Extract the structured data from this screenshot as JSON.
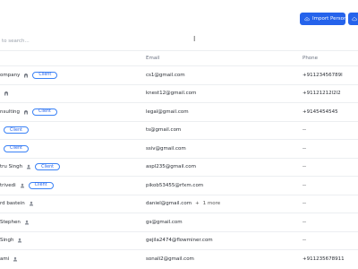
{
  "toolbar": {
    "import_label": "Import Person"
  },
  "search": {
    "placeholder": "to search..."
  },
  "table": {
    "columns": {
      "name": "",
      "email": "Email",
      "phone": "Phone"
    },
    "rows": [
      {
        "name": "ompany",
        "icon": "building-icon",
        "badge": "Client",
        "email": "cs1@gmail.com",
        "phone": "+91123456789l",
        "more": ""
      },
      {
        "name": "",
        "icon": "building-icon",
        "badge": "",
        "email": "knest12@gmail.com",
        "phone": "+91121212l2l2",
        "more": ""
      },
      {
        "name": "nsulting",
        "icon": "building-icon",
        "badge": "Client",
        "email": "legal@gmail.com",
        "phone": "+9145454545",
        "more": ""
      },
      {
        "name": "",
        "icon": "",
        "badge": "Client",
        "email": "ts@gmail.com",
        "phone": "--",
        "more": ""
      },
      {
        "name": "",
        "icon": "",
        "badge": "Client",
        "email": "ssiv@gmail.com",
        "phone": "--",
        "more": ""
      },
      {
        "name": "tru Singh",
        "icon": "person-icon",
        "badge": "Client",
        "email": "aspl235@gmail.com",
        "phone": "--",
        "more": ""
      },
      {
        "name": "trivedi",
        "icon": "person-icon",
        "badge": "Client",
        "email": "pikob53455@rfxm.com",
        "phone": "--",
        "more": ""
      },
      {
        "name": "rd bastein",
        "icon": "person-icon",
        "badge": "",
        "email": "daniel@gmail.com",
        "phone": "--",
        "more": "1 more"
      },
      {
        "name": "Stephen",
        "icon": "person-icon",
        "badge": "",
        "email": "gs@gmail.com",
        "phone": "--",
        "more": ""
      },
      {
        "name": "Singh",
        "icon": "person-icon",
        "badge": "",
        "email": "gejila2474@flowminer.com",
        "phone": "--",
        "more": ""
      },
      {
        "name": "ami",
        "icon": "person-icon",
        "badge": "",
        "email": "sonali2@gmail.com",
        "phone": "+911235678911",
        "more": ""
      }
    ]
  },
  "colors": {
    "accent": "#2563eb",
    "border": "#eceef1",
    "muted": "#6b7280"
  }
}
